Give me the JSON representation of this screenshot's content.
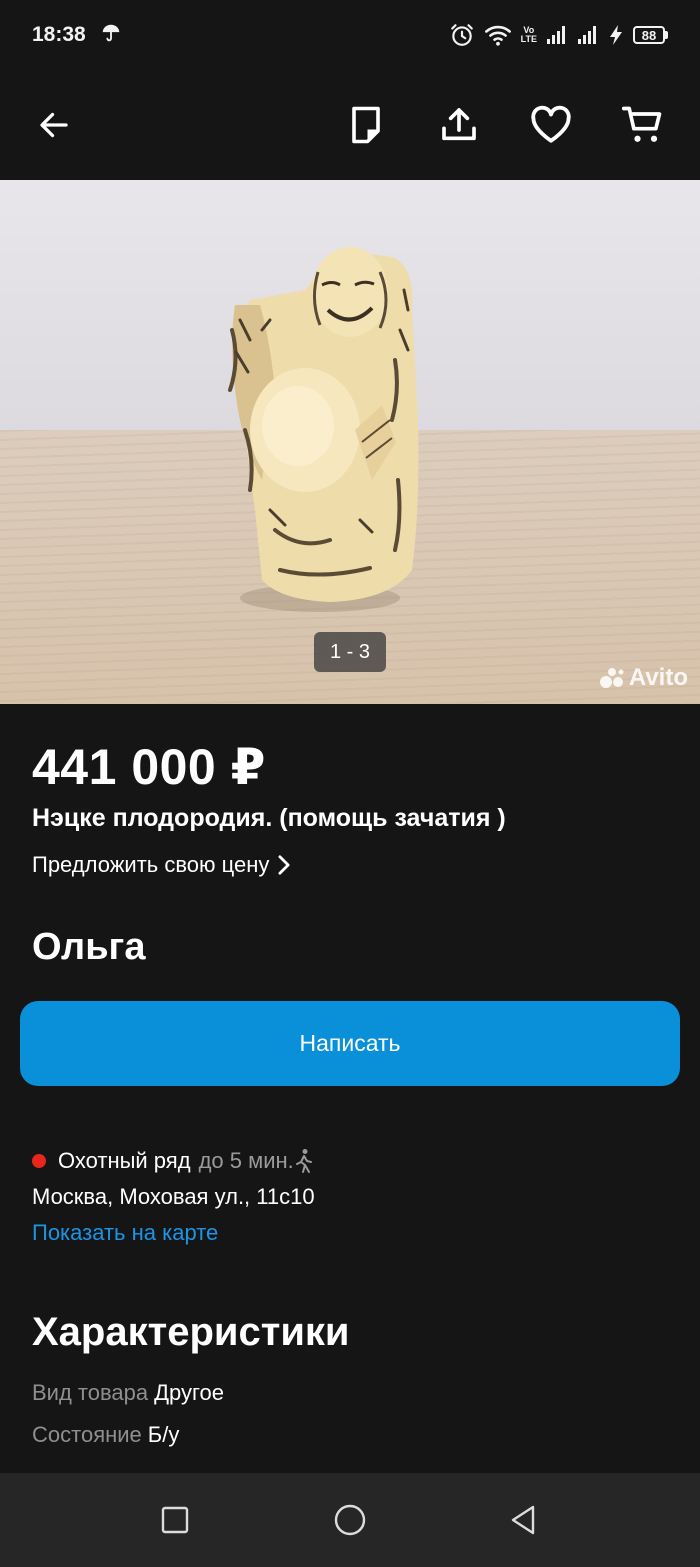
{
  "status_bar": {
    "time": "18:38",
    "volte_top": "Vo",
    "volte_bottom": "LTE",
    "battery_level": "88",
    "icons": [
      "umbrella-icon",
      "alarm-icon",
      "wifi-icon",
      "signal-icon",
      "signal-icon",
      "charging-icon",
      "battery-icon"
    ]
  },
  "toolbar": {
    "icons": [
      "back-arrow-icon",
      "note-icon",
      "share-icon",
      "heart-icon",
      "cart-icon"
    ]
  },
  "gallery": {
    "counter": "1 - 3",
    "watermark": "Avito"
  },
  "listing": {
    "price": "441 000 ₽",
    "title": "Нэцке плодородия. (помощь зачатия )",
    "offer_price_label": "Предложить свою цену"
  },
  "seller": {
    "name": "Ольга",
    "write_button": "Написать"
  },
  "location": {
    "metro_station": "Охотный ряд",
    "metro_time": "до 5 мин.",
    "metro_color": "#e8261c",
    "address": "Москва, Моховая ул., 11с10",
    "show_on_map": "Показать на карте"
  },
  "characteristics": {
    "title": "Характеристики",
    "items": [
      {
        "key": "Вид товара",
        "value": "Другое"
      },
      {
        "key": "Состояние",
        "value": "Б/у"
      }
    ]
  },
  "colors": {
    "background": "#151515",
    "accent": "#0a8fd9",
    "link": "#1a95e6",
    "muted_text": "#8f8f8f"
  },
  "nav_bar": {
    "icons": [
      "square-recents-icon",
      "circle-home-icon",
      "triangle-back-icon"
    ]
  }
}
